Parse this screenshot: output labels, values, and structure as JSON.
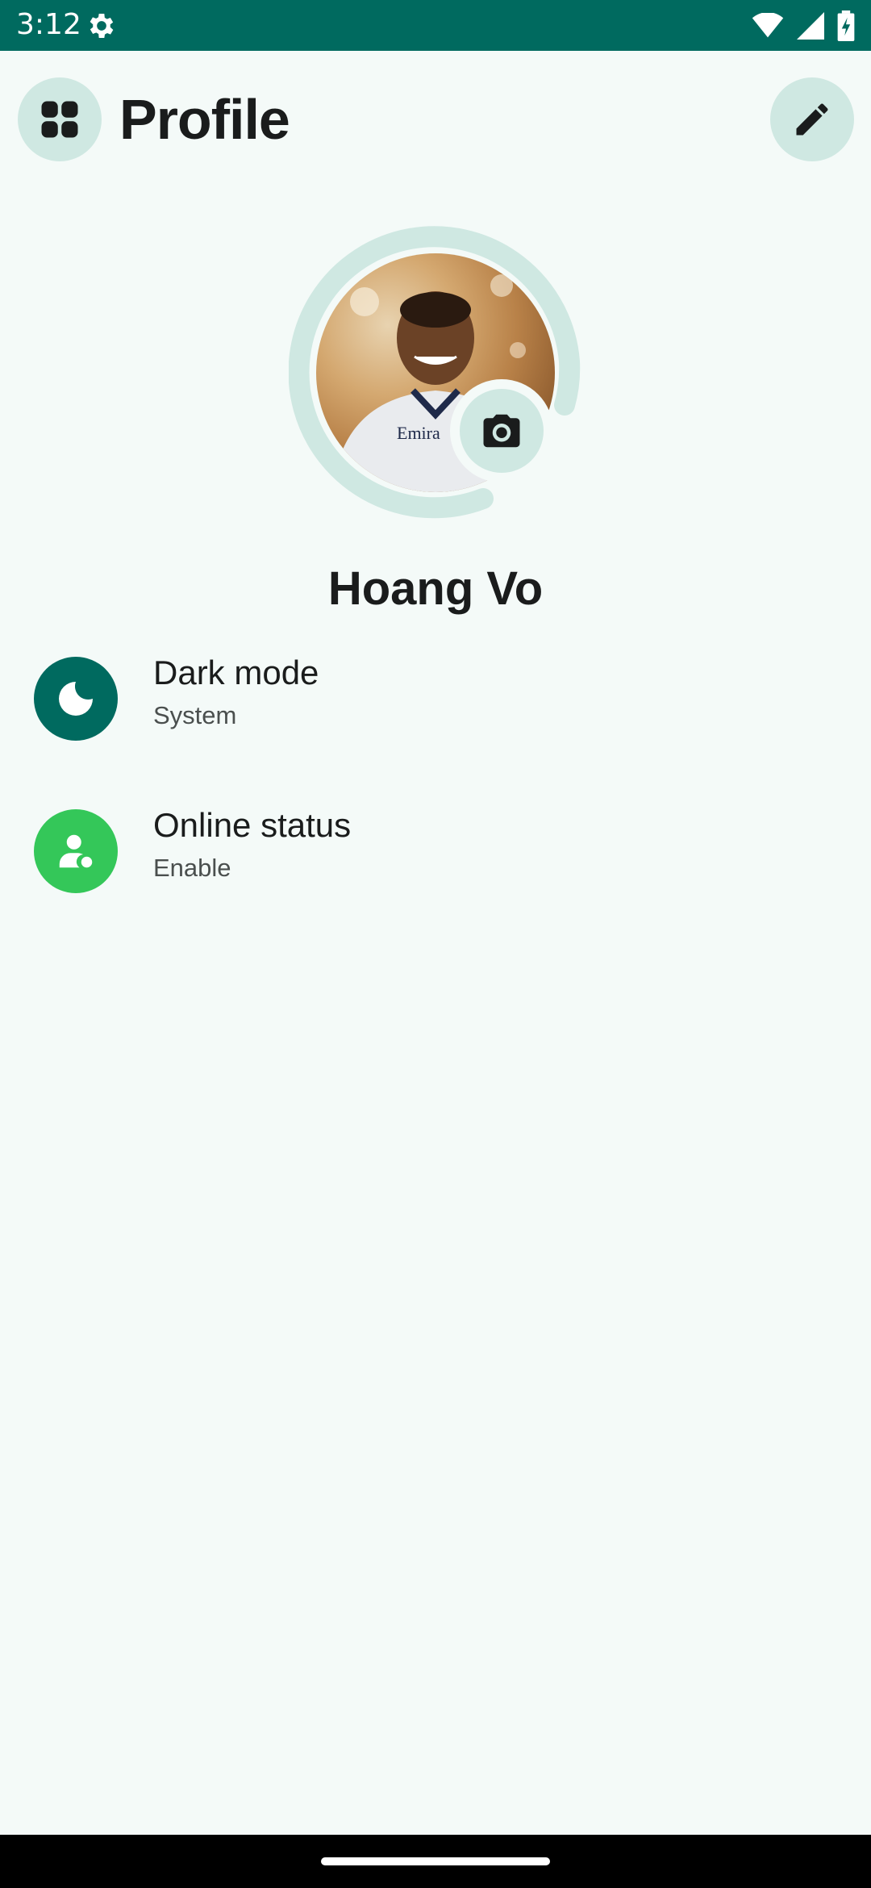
{
  "status_bar": {
    "time": "3:12",
    "icons": [
      "settings-gear-icon",
      "wifi-icon",
      "cellular-signal-icon",
      "battery-charging-icon"
    ]
  },
  "header": {
    "title": "Profile",
    "menu_icon": "apps-grid-icon",
    "edit_icon": "pencil-icon"
  },
  "profile": {
    "name": "Hoang Vo",
    "camera_icon": "camera-icon"
  },
  "settings": [
    {
      "title": "Dark mode",
      "subtitle": "System",
      "icon": "moon-icon",
      "icon_bg": "#006A5F"
    },
    {
      "title": "Online status",
      "subtitle": "Enable",
      "icon": "person-status-icon",
      "icon_bg": "#34C759"
    }
  ],
  "colors": {
    "accent": "#006A5F",
    "accent_light": "#CFE8E2",
    "online_green": "#34C759",
    "background": "#F4FAF8"
  }
}
